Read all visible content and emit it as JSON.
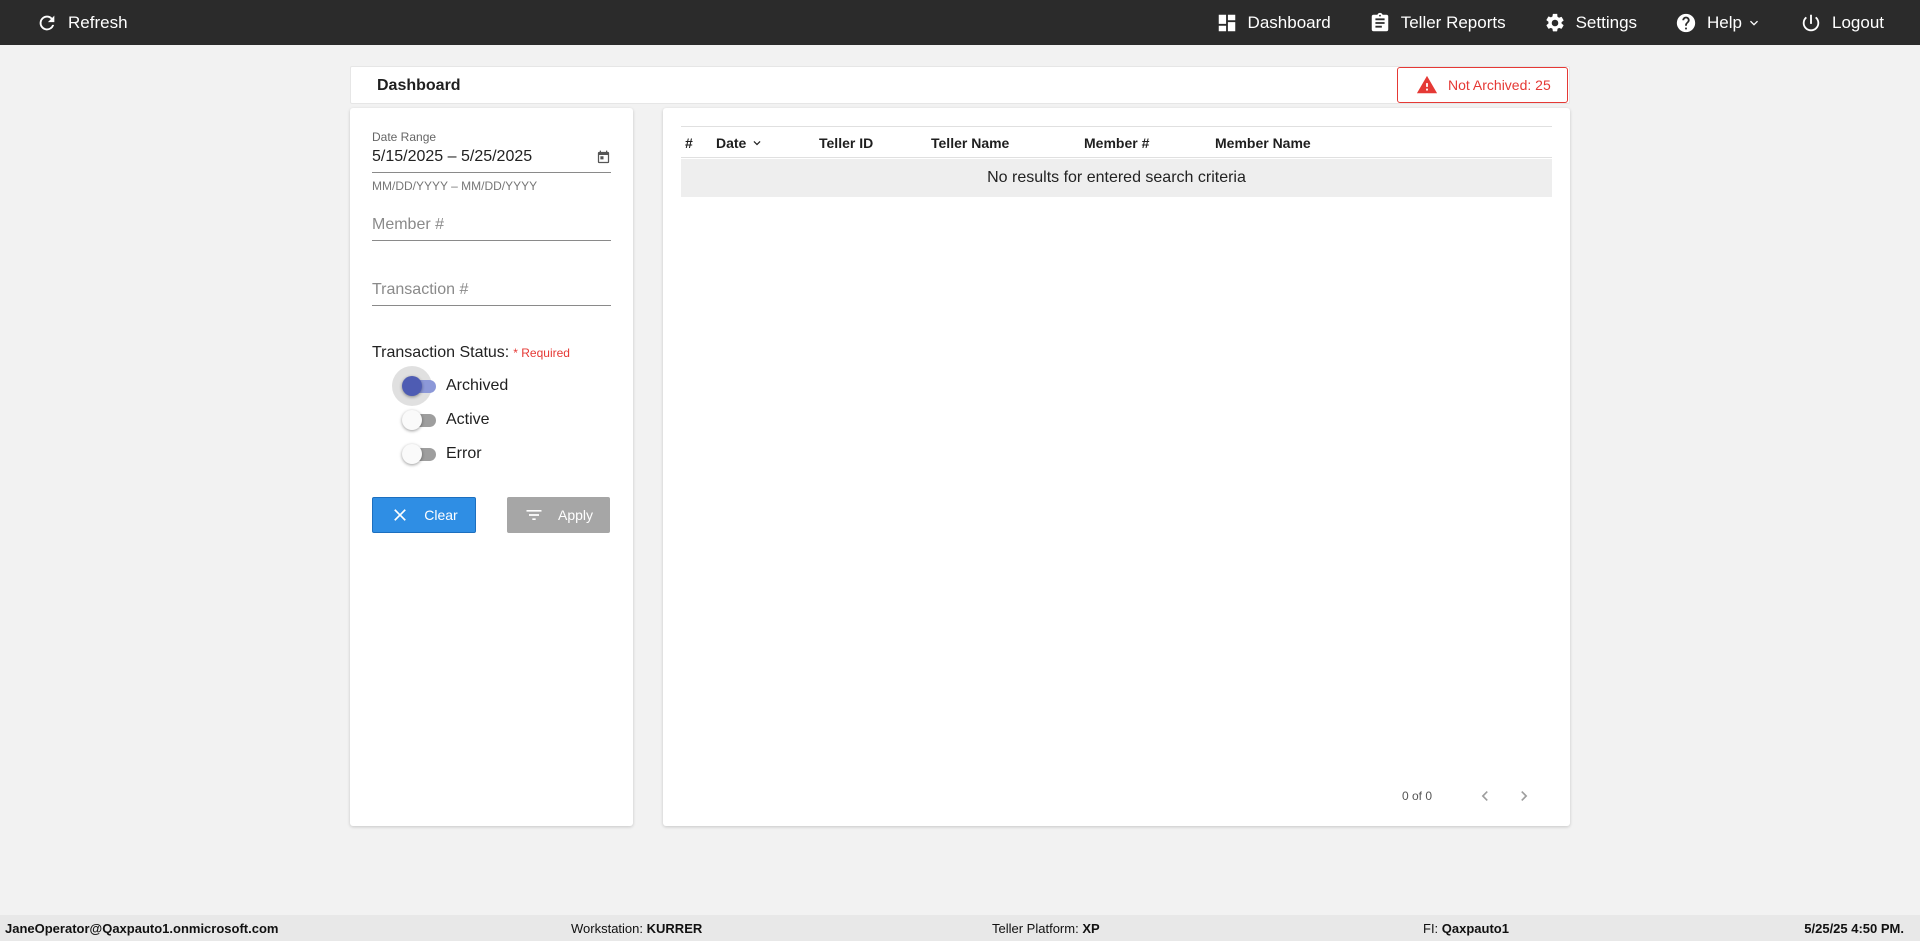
{
  "nav": {
    "refresh": "Refresh",
    "dashboard": "Dashboard",
    "teller_reports": "Teller Reports",
    "settings": "Settings",
    "help": "Help",
    "logout": "Logout"
  },
  "header": {
    "title": "Dashboard",
    "not_archived": "Not Archived: 25"
  },
  "filters": {
    "date_range_label": "Date Range",
    "date_range_value": "5/15/2025 – 5/25/2025",
    "date_hint": "MM/DD/YYYY – MM/DD/YYYY",
    "member_placeholder": "Member #",
    "transaction_placeholder": "Transaction #",
    "status_label": "Transaction Status:",
    "required": "* Required",
    "toggles": [
      {
        "label": "Archived",
        "on": true
      },
      {
        "label": "Active",
        "on": false
      },
      {
        "label": "Error",
        "on": false
      }
    ],
    "clear_label": "Clear",
    "apply_label": "Apply"
  },
  "table": {
    "columns": [
      "#",
      "Date",
      "Teller ID",
      "Teller Name",
      "Member #",
      "Member Name"
    ],
    "empty_message": "No results for entered search criteria",
    "pager": "0 of 0"
  },
  "footer": {
    "user": "JaneOperator@Qaxpauto1.onmicrosoft.com",
    "workstation_label": "Workstation:",
    "workstation_value": "KURRER",
    "platform_label": "Teller Platform:",
    "platform_value": "XP",
    "fi_label": "FI:",
    "fi_value": "Qaxpauto1",
    "datetime": "5/25/25 4:50 PM."
  }
}
